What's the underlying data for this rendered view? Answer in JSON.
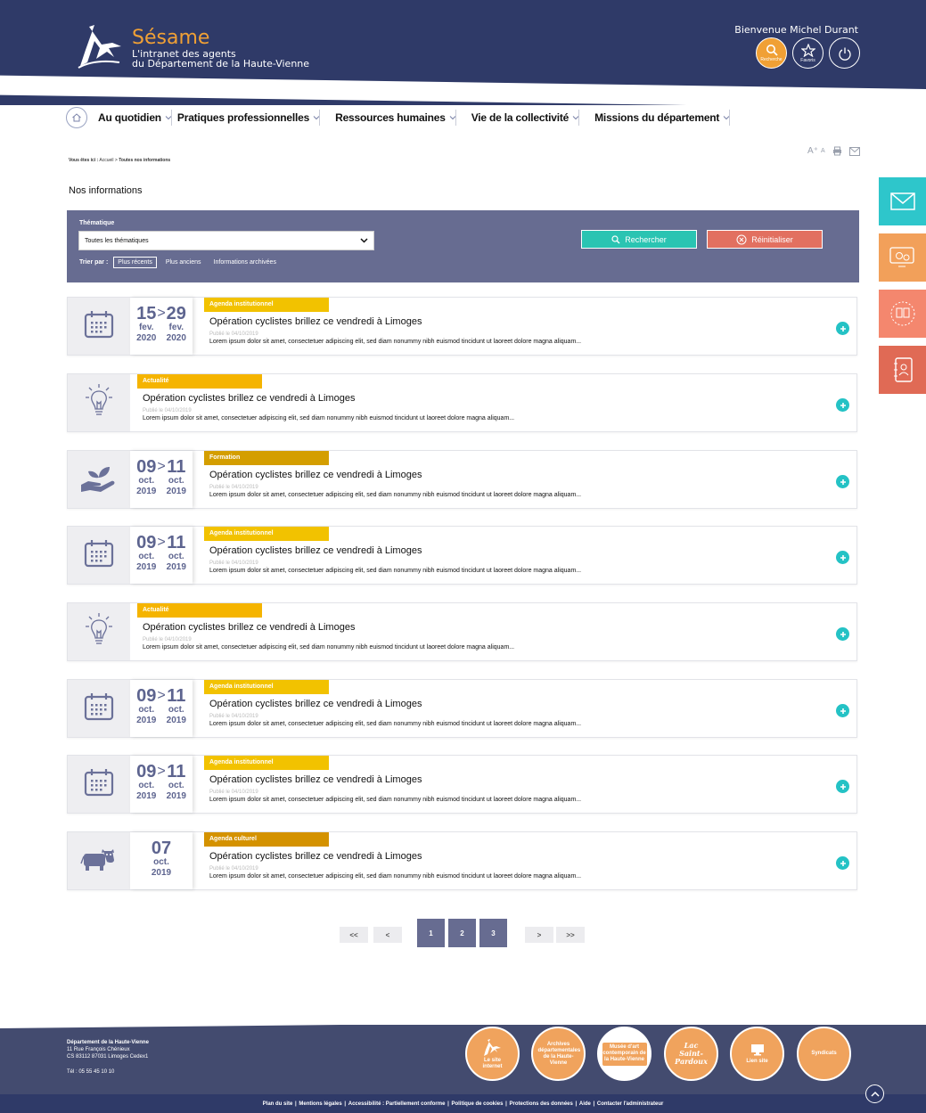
{
  "header": {
    "brand_name": "Sésame",
    "brand_sub_1": "L'intranet des agents",
    "brand_sub_2": "du Département de la Haute-Vienne",
    "welcome": "Bienvenue Michel Durant",
    "search_label": "Recherche",
    "favorites_label": "Favoris"
  },
  "nav": {
    "items": [
      {
        "label": "Au quotidien"
      },
      {
        "label": "Pratiques professionnelles"
      },
      {
        "label": "Ressources humaines"
      },
      {
        "label": "Vie de la collectivité"
      },
      {
        "label": "Missions du département"
      }
    ]
  },
  "breadcrumb": {
    "prefix": "Vous êtes ici :",
    "home": "Accueil",
    "sep": ">",
    "current": "Toutes nos informations"
  },
  "tools": {
    "font_larger": "A⁺",
    "font_smaller": "A"
  },
  "page_title": "Nos informations",
  "filter": {
    "label": "Thématique",
    "select_value": "Toutes les thématiques",
    "sort_label": "Trier par :",
    "sort_options": [
      "Plus récents",
      "Plus anciens",
      "Informations archivées"
    ],
    "search_button": "Rechercher",
    "reset_button": "Réinitialiser"
  },
  "cards": [
    {
      "icon": "calendar-icon",
      "tag": "Agenda institutionnel",
      "tag_color": "#f2c200",
      "date_start": {
        "d": "15",
        "m": "fev.",
        "y": "2020"
      },
      "date_end": {
        "d": "29",
        "m": "fev.",
        "y": "2020"
      },
      "title": "Opération cyclistes brillez ce vendredi à Limoges",
      "published": "Publié le 04/10/2019",
      "desc": "Lorem ipsum dolor sit amet, consectetuer adipiscing elit, sed diam nonummy nibh euismod tincidunt ut laoreet dolore magna aliquam..."
    },
    {
      "icon": "lightbulb-icon",
      "tag": "Actualité",
      "tag_color": "#f5b400",
      "title": "Opération cyclistes brillez ce vendredi à Limoges",
      "published": "Publié le 04/10/2019",
      "desc": "Lorem ipsum dolor sit amet, consectetuer adipiscing elit, sed diam nonummy nibh euismod tincidunt ut laoreet dolore magna aliquam..."
    },
    {
      "icon": "hand-plant-icon",
      "tag": "Formation",
      "tag_color": "#d49e00",
      "date_start": {
        "d": "09",
        "m": "oct.",
        "y": "2019"
      },
      "date_end": {
        "d": "11",
        "m": "oct.",
        "y": "2019"
      },
      "title": "Opération cyclistes brillez ce vendredi à Limoges",
      "published": "Publié le 04/10/2019",
      "desc": "Lorem ipsum dolor sit amet, consectetuer adipiscing elit, sed diam nonummy nibh euismod tincidunt ut laoreet dolore magna aliquam..."
    },
    {
      "icon": "calendar-icon",
      "tag": "Agenda institutionnel",
      "tag_color": "#f2c200",
      "date_start": {
        "d": "09",
        "m": "oct.",
        "y": "2019"
      },
      "date_end": {
        "d": "11",
        "m": "oct.",
        "y": "2019"
      },
      "title": "Opération cyclistes brillez ce vendredi à Limoges",
      "published": "Publié le 04/10/2019",
      "desc": "Lorem ipsum dolor sit amet, consectetuer adipiscing elit, sed diam nonummy nibh euismod tincidunt ut laoreet dolore magna aliquam..."
    },
    {
      "icon": "lightbulb-icon",
      "tag": "Actualité",
      "tag_color": "#f5b400",
      "title": "Opération cyclistes brillez ce vendredi à Limoges",
      "published": "Publié le 04/10/2019",
      "desc": "Lorem ipsum dolor sit amet, consectetuer adipiscing elit, sed diam nonummy nibh euismod tincidunt ut laoreet dolore magna aliquam..."
    },
    {
      "icon": "calendar-icon",
      "tag": "Agenda institutionnel",
      "tag_color": "#f2c200",
      "date_start": {
        "d": "09",
        "m": "oct.",
        "y": "2019"
      },
      "date_end": {
        "d": "11",
        "m": "oct.",
        "y": "2019"
      },
      "title": "Opération cyclistes brillez ce vendredi à Limoges",
      "published": "Publié le 04/10/2019",
      "desc": "Lorem ipsum dolor sit amet, consectetuer adipiscing elit, sed diam nonummy nibh euismod tincidunt ut laoreet dolore magna aliquam..."
    },
    {
      "icon": "calendar-icon",
      "tag": "Agenda institutionnel",
      "tag_color": "#f2c200",
      "date_start": {
        "d": "09",
        "m": "oct.",
        "y": "2019"
      },
      "date_end": {
        "d": "11",
        "m": "oct.",
        "y": "2019"
      },
      "title": "Opération cyclistes brillez ce vendredi à Limoges",
      "published": "Publié le 04/10/2019",
      "desc": "Lorem ipsum dolor sit amet, consectetuer adipiscing elit, sed diam nonummy nibh euismod tincidunt ut laoreet dolore magna aliquam..."
    },
    {
      "icon": "cow-icon",
      "tag": "Agenda culturel",
      "tag_color": "#d49200",
      "date_start": {
        "d": "07",
        "m": "oct.",
        "y": "2019"
      },
      "title": "Opération cyclistes brillez ce vendredi à Limoges",
      "published": "Publié le 04/10/2019",
      "desc": "Lorem ipsum dolor sit amet, consectetuer adipiscing elit, sed diam nonummy nibh euismod tincidunt ut laoreet dolore magna aliquam..."
    }
  ],
  "pagination": {
    "first": "<<",
    "prev": "<",
    "pages": [
      "1",
      "2",
      "3"
    ],
    "next": ">",
    "last": ">>"
  },
  "footer": {
    "org": "Département de la Haute-Vienne",
    "addr1": "11 Rue François Chénieux",
    "addr2": "CS 83112 87031 Limoges Cedex1",
    "tel": "Tél : 05 55 45 10 10",
    "circles": [
      {
        "label": "Le site internet"
      },
      {
        "label": "Archives départementales de la Haute-Vienne"
      },
      {
        "label": "Musée d'art contemporain de la Haute-Vienne"
      },
      {
        "label": "Lac Saint-Pardoux"
      },
      {
        "label": "Lien site"
      },
      {
        "label": "Syndicats"
      }
    ],
    "links": [
      "Plan du site",
      "Mentions légales",
      "Accessibilité : Partiellement conforme",
      "Politique de cookies",
      "Protections des données",
      "Aide",
      "Contacter l'administrateur"
    ]
  },
  "colors": {
    "header_bg": "#2f3a68",
    "accent_orange": "#f0a035",
    "filter_bg": "#676c91",
    "teal": "#2ac4b2",
    "reset": "#e27060"
  }
}
